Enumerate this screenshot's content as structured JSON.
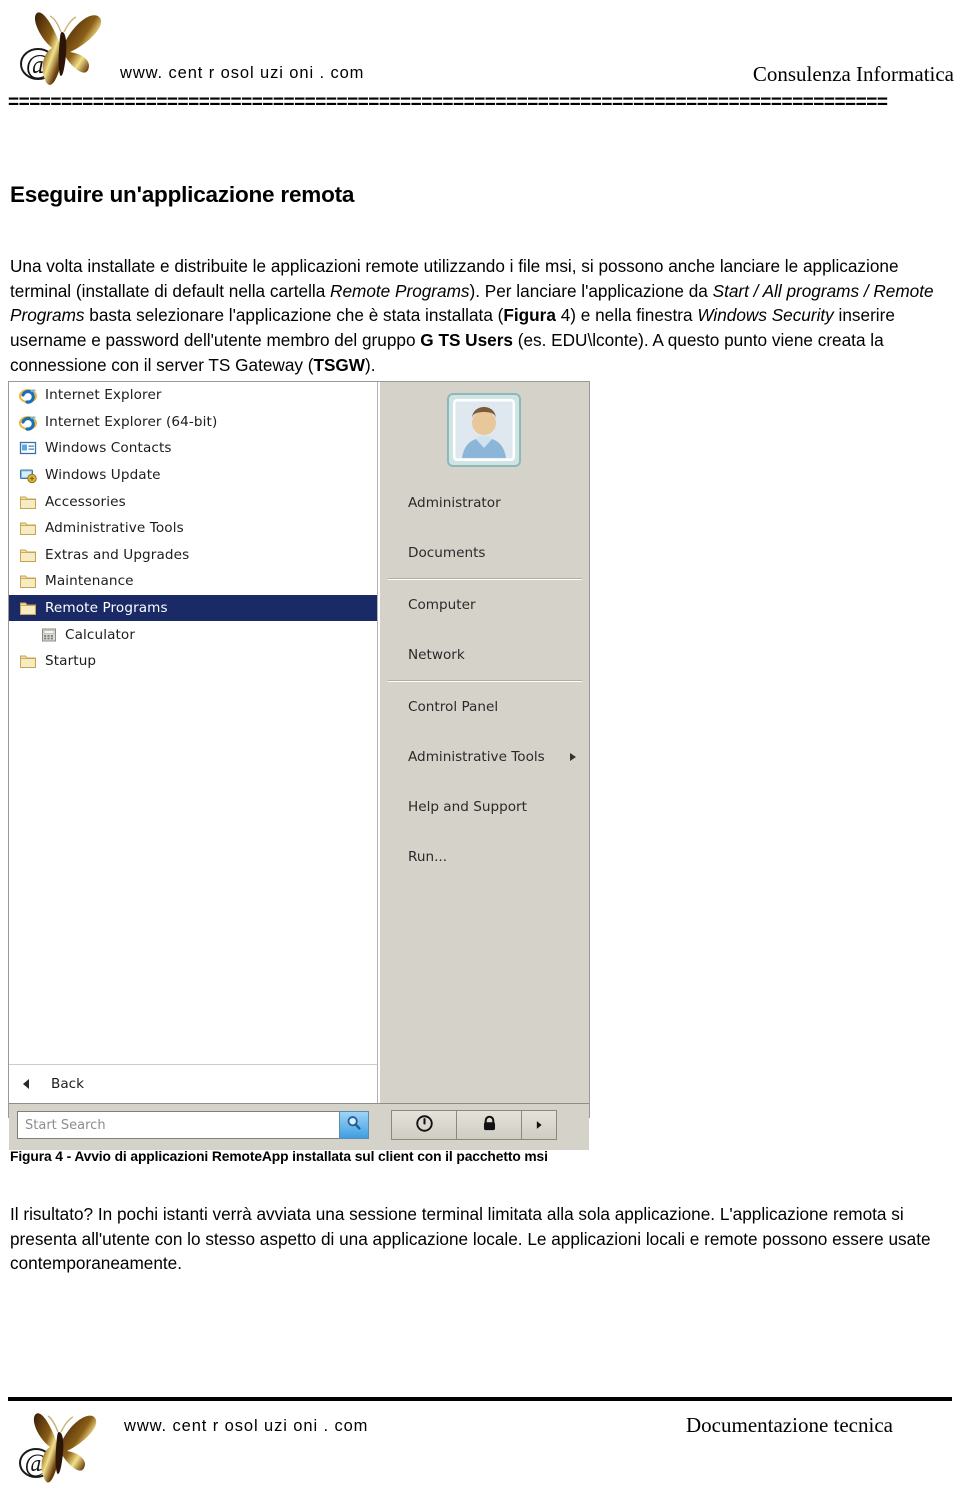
{
  "header": {
    "url": "www. cent r osol uzi oni . com",
    "tagline": "Consulenza Informatica",
    "rule": "===================================================================================",
    "logo_icon": "butterfly-at-logo"
  },
  "document": {
    "title": "Eseguire un'applicazione remota",
    "paragraph_1": {
      "segments": [
        {
          "text": "Una volta installate e distribuite le applicazioni remote utilizzando i file msi, si possono anche lanciare le applicazione terminal (installate di default nella cartella ",
          "style": "normal"
        },
        {
          "text": "Remote Programs",
          "style": "italic"
        },
        {
          "text": "). Per lanciare l'applicazione da ",
          "style": "normal"
        },
        {
          "text": "Start / All programs / Remote Programs",
          "style": "italic"
        },
        {
          "text": " basta selezionare l'applicazione che è stata installata (",
          "style": "normal"
        },
        {
          "text": "Figura",
          "style": "bold"
        },
        {
          "text": " 4) e nella finestra ",
          "style": "normal"
        },
        {
          "text": "Windows Security",
          "style": "italic"
        },
        {
          "text": " inserire username e password dell'utente membro del gruppo ",
          "style": "normal"
        },
        {
          "text": "G TS Users",
          "style": "bold"
        },
        {
          "text": " (es. EDU\\lconte). A questo punto viene creata la connessione con il server TS Gateway (",
          "style": "normal"
        },
        {
          "text": "TSGW",
          "style": "bold"
        },
        {
          "text": ").",
          "style": "normal"
        }
      ]
    },
    "figure_caption": "Figura 4 - Avvio di applicazioni RemoteApp installata sul client con il pacchetto msi",
    "paragraph_2": {
      "segments": [
        {
          "text": "Il risultato? In pochi istanti verrà avviata una sessione terminal limitata alla sola applicazione. L'applicazione remota si presenta all'utente con lo stesso aspetto di una applicazione locale. Le applicazioni locali e remote possono essere usate contemporaneamente.",
          "style": "normal"
        }
      ]
    }
  },
  "screenshot": {
    "programs_menu": {
      "items": [
        {
          "label": "Internet Explorer",
          "icon": "internet-explorer-icon",
          "indent": false,
          "selected": false
        },
        {
          "label": "Internet Explorer (64-bit)",
          "icon": "internet-explorer-icon",
          "indent": false,
          "selected": false
        },
        {
          "label": "Windows Contacts",
          "icon": "windows-contacts-icon",
          "indent": false,
          "selected": false
        },
        {
          "label": "Windows Update",
          "icon": "windows-update-icon",
          "indent": false,
          "selected": false
        },
        {
          "label": "Accessories",
          "icon": "folder-icon",
          "indent": false,
          "selected": false
        },
        {
          "label": "Administrative Tools",
          "icon": "folder-icon",
          "indent": false,
          "selected": false
        },
        {
          "label": "Extras and Upgrades",
          "icon": "folder-icon",
          "indent": false,
          "selected": false
        },
        {
          "label": "Maintenance",
          "icon": "folder-icon",
          "indent": false,
          "selected": false
        },
        {
          "label": "Remote Programs",
          "icon": "folder-icon",
          "indent": false,
          "selected": true
        },
        {
          "label": "Calculator",
          "icon": "calculator-icon",
          "indent": true,
          "selected": false
        },
        {
          "label": "Startup",
          "icon": "folder-icon",
          "indent": false,
          "selected": false
        }
      ],
      "selection_color": "#1a2a66"
    },
    "right_pane": {
      "avatar_icon": "user-avatar-icon",
      "groups": [
        [
          "Administrator",
          "Documents"
        ],
        [
          "Computer",
          "Network"
        ],
        [
          "Control Panel",
          "Administrative Tools",
          "Help and Support",
          "Run..."
        ]
      ],
      "submenu_item": "Administrative Tools"
    },
    "back_label": "Back",
    "back_icon": "left-triangle-icon",
    "search": {
      "placeholder": "Start Search",
      "value": "",
      "button_icon": "search-magnifier-icon"
    },
    "bottom_buttons": [
      {
        "name": "power-button",
        "icon": "power-icon"
      },
      {
        "name": "lock-button",
        "icon": "padlock-icon"
      },
      {
        "name": "shutdown-options-button",
        "icon": "right-triangle-icon"
      }
    ]
  },
  "footer": {
    "url": "www. cent r osol uzi oni . com",
    "tagline": "Documentazione tecnica",
    "logo_icon": "butterfly-at-logo"
  }
}
